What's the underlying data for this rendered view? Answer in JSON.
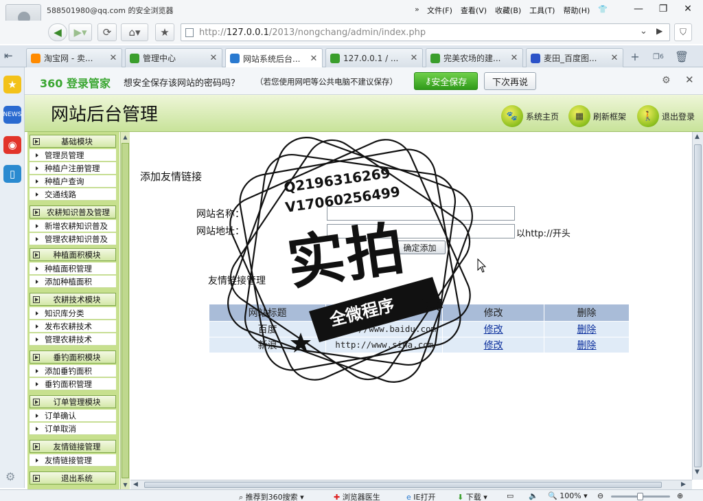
{
  "browser": {
    "account_label": "588501980@qq.com 的安全浏览器",
    "menus": [
      "文件(F)",
      "查看(V)",
      "收藏(B)",
      "工具(T)",
      "帮助(H)"
    ],
    "address_url_prefix": "http://",
    "address_url_host": "127.0.0.1",
    "address_url_path": "/2013/nongchang/admin/index.php",
    "tabs": [
      {
        "label": "淘宝网 - 卖...",
        "icon_color": "#ff8a00",
        "active": false
      },
      {
        "label": "管理中心",
        "icon_color": "#3a9e2c",
        "active": false
      },
      {
        "label": "网站系统后台...",
        "icon_color": "#2a7ad0",
        "active": true
      },
      {
        "label": "127.0.0.1 / ...",
        "icon_color": "#3a9e2c",
        "active": false
      },
      {
        "label": "完美农场的建...",
        "icon_color": "#3a9e2c",
        "active": false
      },
      {
        "label": "麦田_百度图...",
        "icon_color": "#2b52c8",
        "active": false
      }
    ],
    "tab_count_badge": "6"
  },
  "password_bar": {
    "logo": "360 登录管家",
    "message": "想安全保存该网站的密码吗？",
    "hint": "（若您使用网吧等公共电脑不建议保存）",
    "save_label": "安全保存",
    "later_label": "下次再说"
  },
  "app": {
    "title": "网站后台管理",
    "header_buttons": [
      "系统主页",
      "刷新框架",
      "退出登录"
    ],
    "menu": [
      {
        "group": "基础模块",
        "items": [
          "管理员管理",
          "种植户注册管理",
          "种植户查询",
          "交通线路"
        ]
      },
      {
        "group": "农耕知识普及管理",
        "items": [
          "新增农耕知识普及",
          "管理农耕知识普及"
        ]
      },
      {
        "group": "种植面积模块",
        "items": [
          "种植面积管理",
          "添加种植面积"
        ]
      },
      {
        "group": "农耕技术模块",
        "items": [
          "知识库分类",
          "发布农耕技术",
          "管理农耕技术"
        ]
      },
      {
        "group": "垂钓面积模块",
        "items": [
          "添加垂钓面积",
          "垂钓面积管理"
        ]
      },
      {
        "group": "订单管理模块",
        "items": [
          "订单确认",
          "订单取消"
        ]
      },
      {
        "group": "友情链接管理",
        "items": [
          "友情链接管理"
        ]
      },
      {
        "group": "退出系统",
        "items": []
      }
    ]
  },
  "form": {
    "title": "添加友情链接",
    "name_label": "网站名称：",
    "url_label": "网站地址：",
    "url_hint": "以http://开头",
    "submit_label": "确定添加"
  },
  "links_table": {
    "title": "友情链接管理",
    "headers": [
      "网站标题",
      "网站地址",
      "修改",
      "删除"
    ],
    "rows": [
      {
        "title": "百度",
        "url": "http://www.baidu.com",
        "edit": "修改",
        "delete": "删除"
      },
      {
        "title": "新浪",
        "url": "http://www.sina.com",
        "edit": "修改",
        "delete": "删除"
      }
    ]
  },
  "status_bar": {
    "items": [
      "推荐到360搜索",
      "浏览器医生",
      "IE打开",
      "下载"
    ],
    "zoom": "100%"
  },
  "watermark": {
    "line1": "Q2196316269",
    "line2": "V17060256499",
    "big": "实拍",
    "sub": "全微程序"
  }
}
